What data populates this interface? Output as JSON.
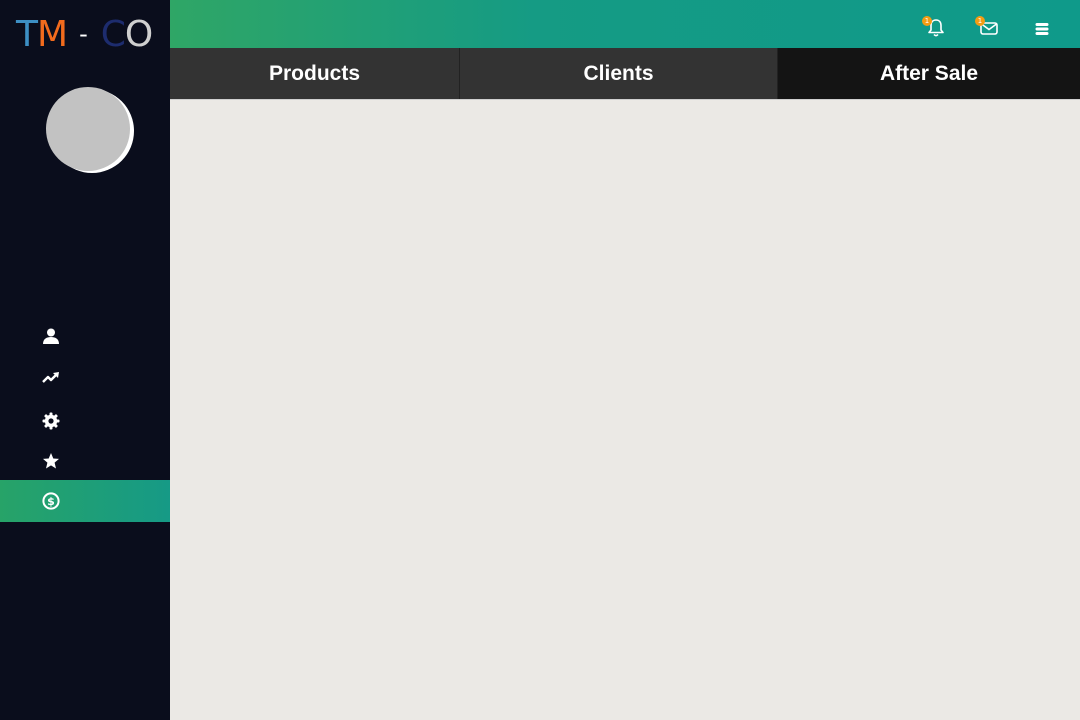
{
  "brand": {
    "logo": [
      {
        "ch": "T",
        "color": "#3d8fc4"
      },
      {
        "ch": "M",
        "color": "#f26b1d"
      },
      {
        "ch": "-",
        "color": "#ffffff"
      },
      {
        "ch": "C",
        "color": "#1d2c6e"
      },
      {
        "ch": "O",
        "color": "#cfcfcf"
      }
    ]
  },
  "colors": {
    "sidebar_bg": "#0a0d1c",
    "accent_from": "#27a368",
    "accent_to": "#169a86",
    "badge": "#f39c12",
    "tab_bg": "#333333",
    "tab_active_bg": "#141414",
    "content_bg": "#ebe9e5"
  },
  "header": {
    "notifications": {
      "icon": "bell-icon",
      "badge": "1"
    },
    "messages": {
      "icon": "envelope-icon",
      "badge": "1"
    },
    "menu": {
      "icon": "hamburger-icon"
    }
  },
  "sidebar": {
    "items": [
      {
        "icon": "user-icon",
        "active": false
      },
      {
        "icon": "trend-icon",
        "active": false
      },
      {
        "icon": "gear-icon",
        "active": false
      },
      {
        "icon": "star-icon",
        "active": false
      },
      {
        "icon": "dollar-icon",
        "active": true
      }
    ]
  },
  "tabs": [
    {
      "label": "Products",
      "active": false
    },
    {
      "label": "Clients",
      "active": false
    },
    {
      "label": "After Sale",
      "active": true
    }
  ]
}
